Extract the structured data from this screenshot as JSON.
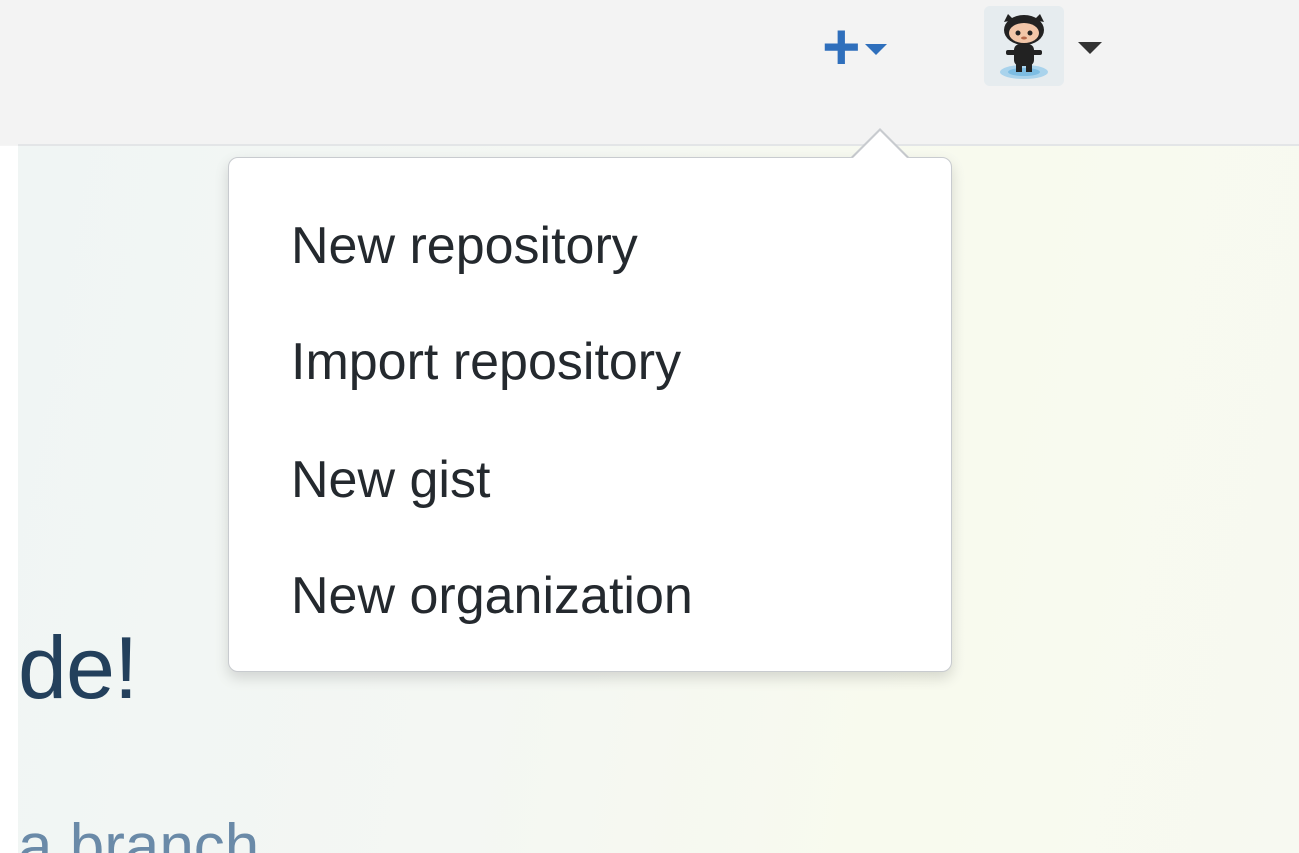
{
  "hero": {
    "title_fragment": "de!",
    "subtitle_fragment": "a branch,"
  },
  "header": {
    "plus_icon": "+",
    "plus_icon_name": "plus-icon",
    "avatar_icon_name": "octocat-avatar"
  },
  "create_menu": {
    "items": [
      {
        "label": "New repository"
      },
      {
        "label": "Import repository"
      },
      {
        "label": "New gist"
      },
      {
        "label": "New organization"
      }
    ]
  },
  "colors": {
    "accent_blue": "#2f6fbc",
    "menu_text": "#24292e",
    "hero_title": "#23405c",
    "hero_subtitle": "#6a8aa8"
  }
}
